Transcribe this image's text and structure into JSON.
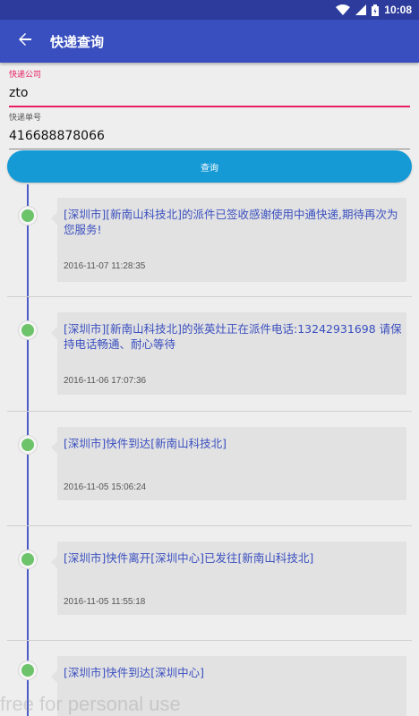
{
  "status_bar": {
    "time": "10:08"
  },
  "app_bar": {
    "title": "快递查询"
  },
  "form": {
    "company_label": "快递公司",
    "company_value": "zto",
    "tracking_label": "快递单号",
    "tracking_value": "416688878066"
  },
  "query_button": "查询",
  "timeline": [
    {
      "text": "[深圳市][新南山科技北]的派件已签收感谢使用中通快递,期待再次为您服务!",
      "time": "2016-11-07 11:28:35"
    },
    {
      "text": "[深圳市][新南山科技北]的张英灶正在派件电话:13242931698 请保持电话畅通、耐心等待",
      "time": "2016-11-06 17:07:36"
    },
    {
      "text": "[深圳市]快件到达[新南山科技北]",
      "time": "2016-11-05 15:06:24"
    },
    {
      "text": "[深圳市]快件离开[深圳中心]已发往[新南山科技北]",
      "time": "2016-11-05 11:55:18"
    },
    {
      "text": "[深圳市]快件到达[深圳中心]",
      "time": ""
    }
  ],
  "watermark": "free for personal use",
  "colors": {
    "primary": "#3a4fbf",
    "status_bar": "#2c3b9c",
    "accent": "#e91e63",
    "button": "#159ad6",
    "dot": "#6cc36a"
  },
  "icons": {
    "back": "arrow-left-icon",
    "wifi": "wifi-icon",
    "signal": "signal-icon",
    "battery": "battery-icon"
  }
}
